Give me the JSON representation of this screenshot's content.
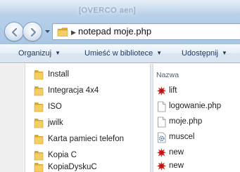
{
  "window": {
    "title": "[OVERCO aen]"
  },
  "address_bar": {
    "path": "notepad moje.php",
    "icon": "folder-icon"
  },
  "command_bar": {
    "items": [
      {
        "label": "Organizuj",
        "arrow": "▼"
      },
      {
        "label": "Umieść w bibliotece",
        "arrow": "▼"
      },
      {
        "label": "Udostępnij",
        "arrow": "▼"
      }
    ]
  },
  "navigation_pane": {
    "items": [
      {
        "label": "Install",
        "icon": "folder-icon"
      },
      {
        "label": "Integracja 4x4",
        "icon": "folder-icon"
      },
      {
        "label": "ISO",
        "icon": "folder-icon"
      },
      {
        "label": "jwilk",
        "icon": "folder-icon"
      },
      {
        "label": "Karta pamieci telefon",
        "icon": "folder-icon"
      },
      {
        "label": "Kopia C",
        "icon": "folder-icon"
      },
      {
        "label": "KopiaDyskuC",
        "icon": "folder-icon"
      }
    ]
  },
  "file_list": {
    "column_header": "Nazwa",
    "files": [
      {
        "name": "lift",
        "icon": "red-splat-icon"
      },
      {
        "name": "logowanie.php",
        "icon": "document-icon"
      },
      {
        "name": "moje.php",
        "icon": "document-icon"
      },
      {
        "name": "muscel",
        "icon": "gear-document-icon"
      },
      {
        "name": "new",
        "icon": "red-splat-icon"
      },
      {
        "name": "new",
        "icon": "red-splat-icon"
      }
    ]
  },
  "colors": {
    "folder": "#e8b93c",
    "splat": "#d42020",
    "command_text": "#1e395b",
    "header_text": "#4c607a"
  }
}
